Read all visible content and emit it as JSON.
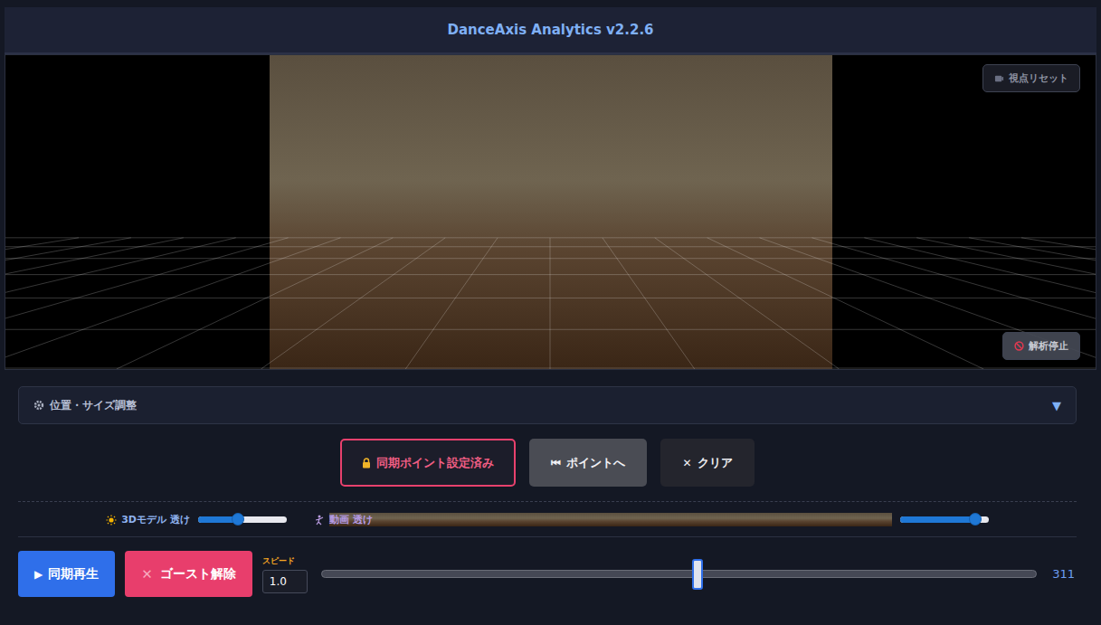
{
  "header": {
    "title": "DanceAxis Analytics v2.2.6"
  },
  "viewport": {
    "reset_label": "視点リセット",
    "stop_label": "解析停止"
  },
  "panel": {
    "label": "位置・サイズ調整",
    "toggle": "▼",
    "expanded": false
  },
  "sync_buttons": [
    {
      "icon": "",
      "label": "同期ポイント設定済み",
      "kind": "locked"
    },
    {
      "icon": "⏮",
      "label": "ポイントへ",
      "kind": "secondary"
    },
    {
      "icon": "✕",
      "label": "クリア",
      "kind": "plain"
    }
  ],
  "sliders": [
    {
      "label": "3Dモデル 透け",
      "level": 0.45,
      "kind": "model"
    },
    {
      "label": "動画 透け",
      "level": 0.85,
      "kind": "video"
    }
  ],
  "playback": {
    "play": {
      "icon": "▶",
      "label": "同期再生"
    },
    "ghost": {
      "icon": "✕",
      "label": "ゴースト解除",
      "active": true
    },
    "speed": {
      "label": "スピード",
      "value": "1.0"
    },
    "timeline": {
      "level": 0.526,
      "reading": "311"
    }
  }
}
